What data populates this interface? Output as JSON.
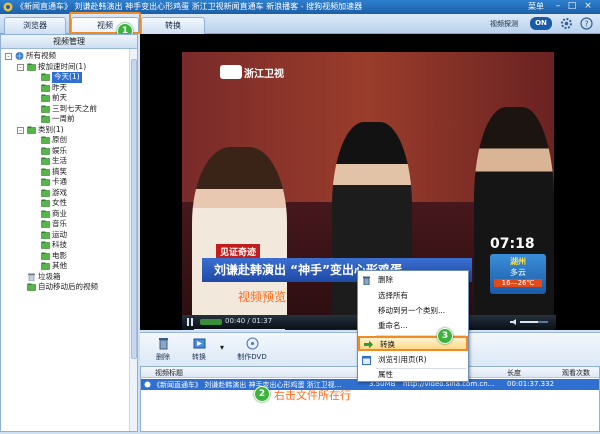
{
  "titlebar": {
    "title": "《新闻直通车》 刘谦赴韩演出 神手变出心形鸡蛋 浙江卫视新闻直通车 新浪播客 - 搜狗视频加速器",
    "menu_label": "菜单",
    "minimize": "–",
    "maximize": "□",
    "close": "×"
  },
  "tabs": [
    {
      "label": "浏览器",
      "active": false
    },
    {
      "label": "视频",
      "active": true
    },
    {
      "label": "转换",
      "active": false
    }
  ],
  "right_tools": {
    "label": "视频探测",
    "toggle": "ON"
  },
  "badges": {
    "one": "1",
    "two": "2",
    "three": "3"
  },
  "sidebar": {
    "header": "视频管理",
    "tree": [
      {
        "label": "所有视频",
        "level": 0,
        "expander": "-",
        "icon": "globe-icon"
      },
      {
        "label": "按加速时间(1)",
        "level": 1,
        "expander": "-",
        "icon": "folder-green-icon"
      },
      {
        "label": "今天(1)",
        "level": 2,
        "icon": "folder-green-icon",
        "selected": true
      },
      {
        "label": "昨天",
        "level": 2,
        "icon": "folder-green-icon"
      },
      {
        "label": "前天",
        "level": 2,
        "icon": "folder-green-icon"
      },
      {
        "label": "三到七天之前",
        "level": 2,
        "icon": "folder-green-icon"
      },
      {
        "label": "一周前",
        "level": 2,
        "icon": "folder-green-icon"
      },
      {
        "label": "类别(1)",
        "level": 1,
        "expander": "-",
        "icon": "folder-green-icon"
      },
      {
        "label": "原创",
        "level": 2,
        "icon": "folder-green-icon"
      },
      {
        "label": "娱乐",
        "level": 2,
        "icon": "folder-green-icon"
      },
      {
        "label": "生活",
        "level": 2,
        "icon": "folder-green-icon"
      },
      {
        "label": "搞笑",
        "level": 2,
        "icon": "folder-green-icon"
      },
      {
        "label": "卡通",
        "level": 2,
        "icon": "folder-green-icon"
      },
      {
        "label": "游戏",
        "level": 2,
        "icon": "folder-green-icon"
      },
      {
        "label": "女性",
        "level": 2,
        "icon": "folder-green-icon"
      },
      {
        "label": "商业",
        "level": 2,
        "icon": "folder-green-icon"
      },
      {
        "label": "音乐",
        "level": 2,
        "icon": "folder-green-icon"
      },
      {
        "label": "运动",
        "level": 2,
        "icon": "folder-green-icon"
      },
      {
        "label": "科技",
        "level": 2,
        "icon": "folder-green-icon"
      },
      {
        "label": "电影",
        "level": 2,
        "icon": "folder-green-icon"
      },
      {
        "label": "其他",
        "level": 2,
        "icon": "folder-green-icon"
      },
      {
        "label": "垃圾箱",
        "level": 1,
        "icon": "trash-icon"
      },
      {
        "label": "自动移动后的视频",
        "level": 1,
        "icon": "folder-green-icon"
      }
    ]
  },
  "video": {
    "station": "浙江卫视",
    "tag": "见证奇迹",
    "caption": "刘谦赴韩演出 “神手”变出心形鸡蛋",
    "overlay_time": "07:18",
    "weather_city": "湖州",
    "weather_cond": "多云",
    "weather_temp": "16—26℃",
    "preview_label": "视频预览",
    "time_display": "00:40 / 01:37"
  },
  "toolbar": {
    "delete": "删除",
    "convert": "转换",
    "dropdown": "▾",
    "make_dvd": "制作DVD"
  },
  "table": {
    "headers": {
      "title": "视频标题",
      "length": "长度",
      "views": "观看次数"
    },
    "rows": [
      {
        "title": "《新闻直通车》 刘谦赴韩演出 神手变出心形鸡蛋 浙江卫视...",
        "size": "3.50MB",
        "url": "http://video.sina.com.cn...",
        "length": "00:01:37.332"
      }
    ]
  },
  "row_annotation": "右击文件所在行",
  "context_menu": [
    {
      "label": "删除",
      "icon": "delete-icon"
    },
    {
      "label": "选择所有",
      "icon": ""
    },
    {
      "label": "移动到另一个类别...",
      "icon": ""
    },
    {
      "label": "重命名...",
      "icon": ""
    },
    {
      "label": "转换",
      "icon": "convert-arrow-icon",
      "highlighted": true
    },
    {
      "label": "浏览引用页(R)",
      "icon": "browser-page-icon"
    },
    {
      "label": "属性",
      "icon": ""
    }
  ],
  "colors": {
    "accent": "#2f6fd0",
    "highlight": "#f08a24",
    "badge": "#3cb33c",
    "annotation": "#ff6a1a"
  }
}
